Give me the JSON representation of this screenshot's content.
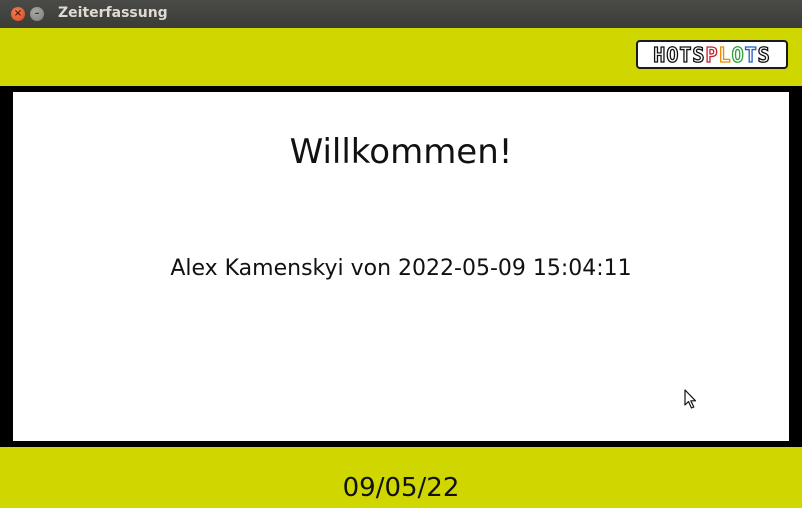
{
  "window": {
    "title": "Zeiterfassung"
  },
  "header": {
    "logo_text": "HOTSPLOTS"
  },
  "main": {
    "welcome": "Willkommen!",
    "message": "Alex Kamenskyi von 2022-05-09 15:04:11"
  },
  "footer": {
    "date": "09/05/22"
  },
  "colors": {
    "accent": "#cfd600",
    "frame": "#000000",
    "panel": "#ffffff"
  }
}
